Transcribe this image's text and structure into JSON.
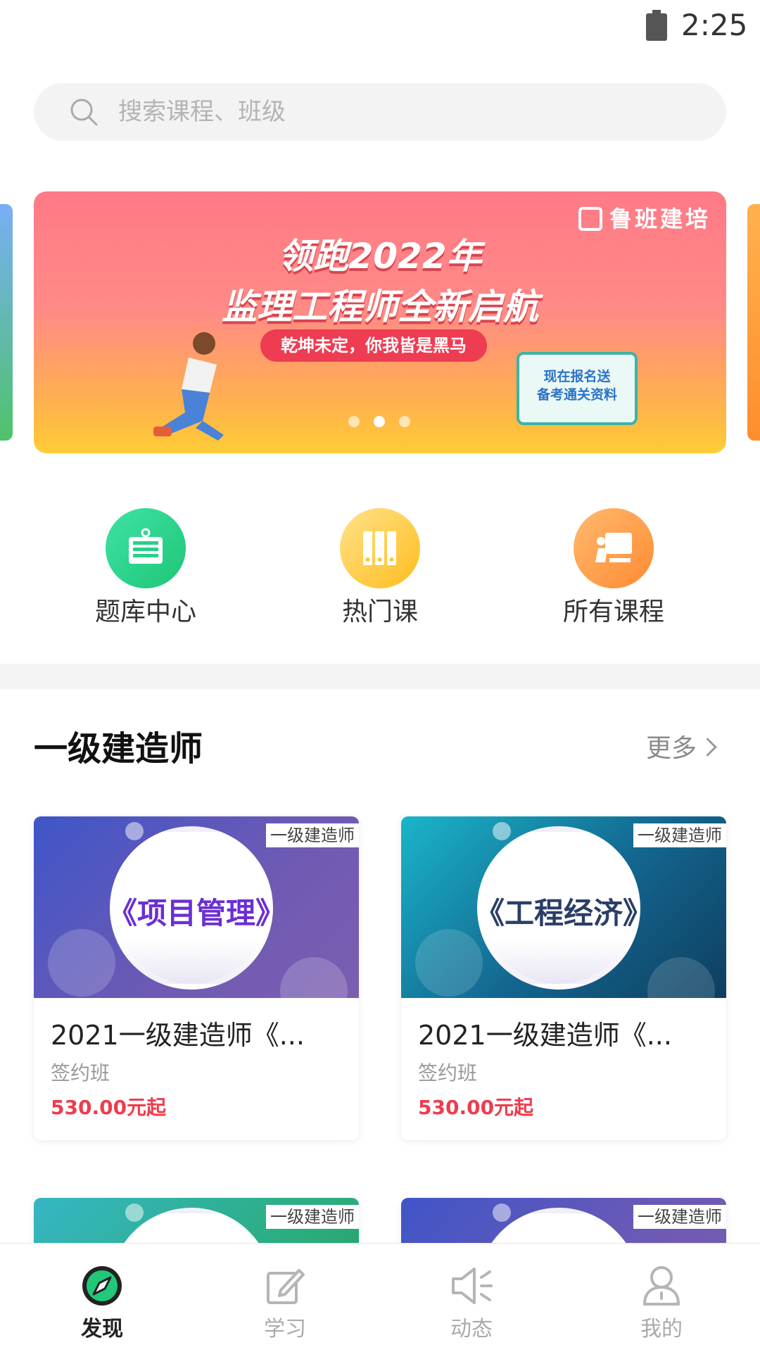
{
  "status_bar": {
    "time": "2:25"
  },
  "search": {
    "placeholder": "搜索课程、班级"
  },
  "banner": {
    "logo": "鲁班建培",
    "headline_1": "领跑2022年",
    "headline_2": "监理工程师全新启航",
    "slogan": "乾坤未定，你我皆是黑马",
    "book_line_1": "现在报名送",
    "book_line_2": "备考通关资料",
    "carousel_total": 3,
    "carousel_active_index": 2
  },
  "categories": [
    {
      "label": "题库中心",
      "icon": "question-bank-icon"
    },
    {
      "label": "热门课",
      "icon": "hot-course-icon"
    },
    {
      "label": "所有课程",
      "icon": "all-courses-icon"
    }
  ],
  "section": {
    "title": "一级建造师",
    "more": "更多"
  },
  "courses": [
    {
      "tag": "一级建造师",
      "subject": "《项目管理》",
      "title": "2021一级建造师《...",
      "type": "签约班",
      "price": "530.00元起"
    },
    {
      "tag": "一级建造师",
      "subject": "《工程经济》",
      "title": "2021一级建造师《...",
      "type": "签约班",
      "price": "530.00元起"
    },
    {
      "tag": "一级建造师"
    },
    {
      "tag": "一级建造师"
    }
  ],
  "nav": [
    {
      "label": "发现",
      "icon": "compass-icon",
      "active": true
    },
    {
      "label": "学习",
      "icon": "edit-icon",
      "active": false
    },
    {
      "label": "动态",
      "icon": "megaphone-icon",
      "active": false
    },
    {
      "label": "我的",
      "icon": "profile-icon",
      "active": false
    }
  ],
  "colors": {
    "accent_green": "#1fc575",
    "price_red": "#f03b4d"
  }
}
